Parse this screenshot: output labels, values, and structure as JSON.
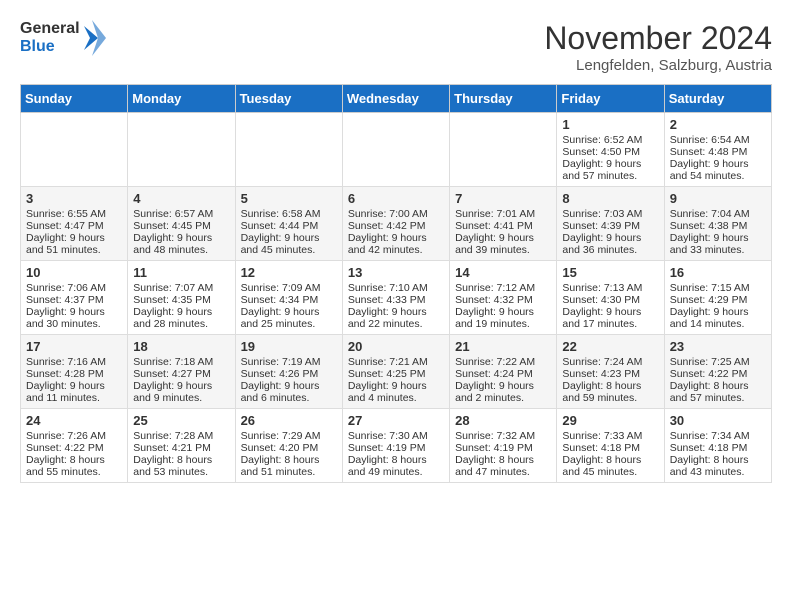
{
  "logo": {
    "line1": "General",
    "line2": "Blue"
  },
  "title": "November 2024",
  "location": "Lengfelden, Salzburg, Austria",
  "weekdays": [
    "Sunday",
    "Monday",
    "Tuesday",
    "Wednesday",
    "Thursday",
    "Friday",
    "Saturday"
  ],
  "weeks": [
    [
      {
        "day": "",
        "info": ""
      },
      {
        "day": "",
        "info": ""
      },
      {
        "day": "",
        "info": ""
      },
      {
        "day": "",
        "info": ""
      },
      {
        "day": "",
        "info": ""
      },
      {
        "day": "1",
        "info": "Sunrise: 6:52 AM\nSunset: 4:50 PM\nDaylight: 9 hours and 57 minutes."
      },
      {
        "day": "2",
        "info": "Sunrise: 6:54 AM\nSunset: 4:48 PM\nDaylight: 9 hours and 54 minutes."
      }
    ],
    [
      {
        "day": "3",
        "info": "Sunrise: 6:55 AM\nSunset: 4:47 PM\nDaylight: 9 hours and 51 minutes."
      },
      {
        "day": "4",
        "info": "Sunrise: 6:57 AM\nSunset: 4:45 PM\nDaylight: 9 hours and 48 minutes."
      },
      {
        "day": "5",
        "info": "Sunrise: 6:58 AM\nSunset: 4:44 PM\nDaylight: 9 hours and 45 minutes."
      },
      {
        "day": "6",
        "info": "Sunrise: 7:00 AM\nSunset: 4:42 PM\nDaylight: 9 hours and 42 minutes."
      },
      {
        "day": "7",
        "info": "Sunrise: 7:01 AM\nSunset: 4:41 PM\nDaylight: 9 hours and 39 minutes."
      },
      {
        "day": "8",
        "info": "Sunrise: 7:03 AM\nSunset: 4:39 PM\nDaylight: 9 hours and 36 minutes."
      },
      {
        "day": "9",
        "info": "Sunrise: 7:04 AM\nSunset: 4:38 PM\nDaylight: 9 hours and 33 minutes."
      }
    ],
    [
      {
        "day": "10",
        "info": "Sunrise: 7:06 AM\nSunset: 4:37 PM\nDaylight: 9 hours and 30 minutes."
      },
      {
        "day": "11",
        "info": "Sunrise: 7:07 AM\nSunset: 4:35 PM\nDaylight: 9 hours and 28 minutes."
      },
      {
        "day": "12",
        "info": "Sunrise: 7:09 AM\nSunset: 4:34 PM\nDaylight: 9 hours and 25 minutes."
      },
      {
        "day": "13",
        "info": "Sunrise: 7:10 AM\nSunset: 4:33 PM\nDaylight: 9 hours and 22 minutes."
      },
      {
        "day": "14",
        "info": "Sunrise: 7:12 AM\nSunset: 4:32 PM\nDaylight: 9 hours and 19 minutes."
      },
      {
        "day": "15",
        "info": "Sunrise: 7:13 AM\nSunset: 4:30 PM\nDaylight: 9 hours and 17 minutes."
      },
      {
        "day": "16",
        "info": "Sunrise: 7:15 AM\nSunset: 4:29 PM\nDaylight: 9 hours and 14 minutes."
      }
    ],
    [
      {
        "day": "17",
        "info": "Sunrise: 7:16 AM\nSunset: 4:28 PM\nDaylight: 9 hours and 11 minutes."
      },
      {
        "day": "18",
        "info": "Sunrise: 7:18 AM\nSunset: 4:27 PM\nDaylight: 9 hours and 9 minutes."
      },
      {
        "day": "19",
        "info": "Sunrise: 7:19 AM\nSunset: 4:26 PM\nDaylight: 9 hours and 6 minutes."
      },
      {
        "day": "20",
        "info": "Sunrise: 7:21 AM\nSunset: 4:25 PM\nDaylight: 9 hours and 4 minutes."
      },
      {
        "day": "21",
        "info": "Sunrise: 7:22 AM\nSunset: 4:24 PM\nDaylight: 9 hours and 2 minutes."
      },
      {
        "day": "22",
        "info": "Sunrise: 7:24 AM\nSunset: 4:23 PM\nDaylight: 8 hours and 59 minutes."
      },
      {
        "day": "23",
        "info": "Sunrise: 7:25 AM\nSunset: 4:22 PM\nDaylight: 8 hours and 57 minutes."
      }
    ],
    [
      {
        "day": "24",
        "info": "Sunrise: 7:26 AM\nSunset: 4:22 PM\nDaylight: 8 hours and 55 minutes."
      },
      {
        "day": "25",
        "info": "Sunrise: 7:28 AM\nSunset: 4:21 PM\nDaylight: 8 hours and 53 minutes."
      },
      {
        "day": "26",
        "info": "Sunrise: 7:29 AM\nSunset: 4:20 PM\nDaylight: 8 hours and 51 minutes."
      },
      {
        "day": "27",
        "info": "Sunrise: 7:30 AM\nSunset: 4:19 PM\nDaylight: 8 hours and 49 minutes."
      },
      {
        "day": "28",
        "info": "Sunrise: 7:32 AM\nSunset: 4:19 PM\nDaylight: 8 hours and 47 minutes."
      },
      {
        "day": "29",
        "info": "Sunrise: 7:33 AM\nSunset: 4:18 PM\nDaylight: 8 hours and 45 minutes."
      },
      {
        "day": "30",
        "info": "Sunrise: 7:34 AM\nSunset: 4:18 PM\nDaylight: 8 hours and 43 minutes."
      }
    ]
  ]
}
